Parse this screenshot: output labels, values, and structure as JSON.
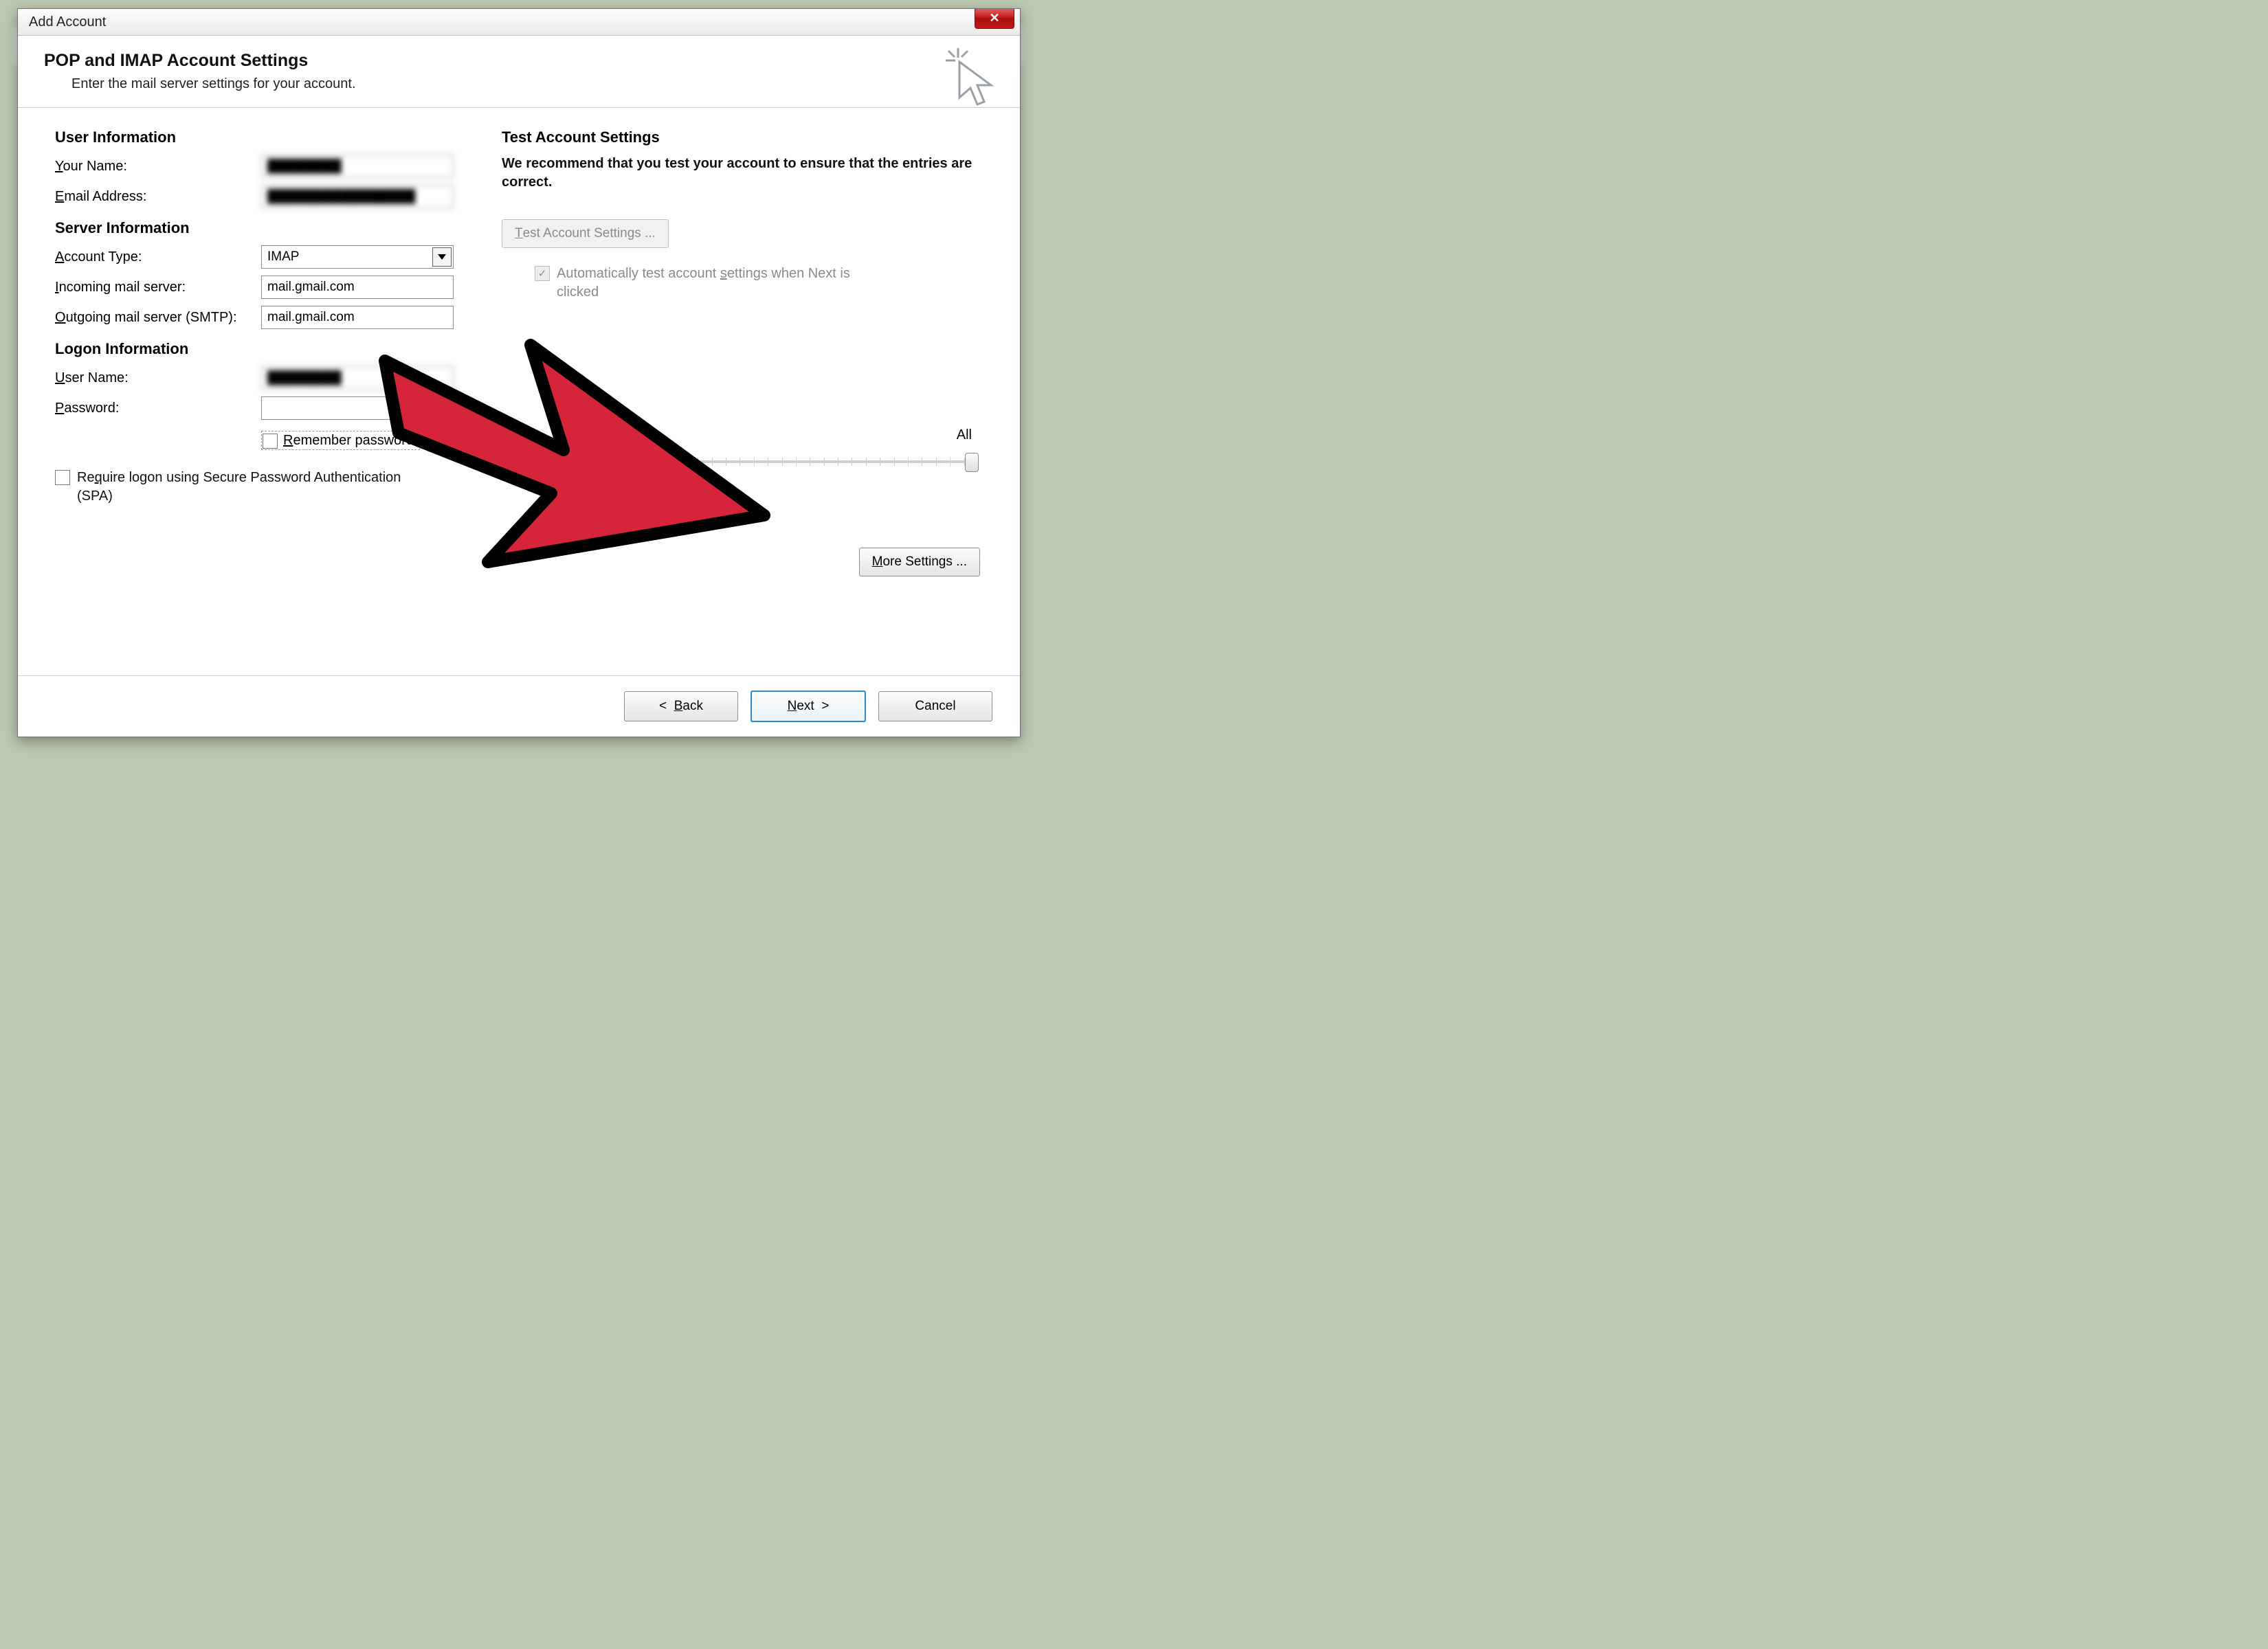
{
  "window": {
    "title": "Add Account",
    "close_glyph": "✕"
  },
  "header": {
    "title": "POP and IMAP Account Settings",
    "subtitle": "Enter the mail server settings for your account."
  },
  "user_info": {
    "heading": "User Information",
    "your_name_label": "Your Name:",
    "your_name_value": "████████",
    "email_label": "Email Address:",
    "email_value": "████████████████"
  },
  "server_info": {
    "heading": "Server Information",
    "account_type_label": "Account Type:",
    "account_type_value": "IMAP",
    "incoming_label": "Incoming mail server:",
    "incoming_value": "mail.gmail.com",
    "outgoing_label": "Outgoing mail server (SMTP):",
    "outgoing_value": "mail.gmail.com"
  },
  "logon": {
    "heading": "Logon Information",
    "user_label": "User Name:",
    "user_value": "████████",
    "password_label": "Password:",
    "password_value": "",
    "remember_label": "Remember password",
    "spa_label": "Require logon using Secure Password Authentication (SPA)"
  },
  "test": {
    "heading": "Test Account Settings",
    "intro": "We recommend that you test your account to ensure that the entries are correct.",
    "button": "Test Account Settings ...",
    "auto_label": "Automatically test account settings when Next is clicked"
  },
  "offline": {
    "all_label": "All"
  },
  "more_settings": "More Settings ...",
  "footer": {
    "back": "<  Back",
    "next": "Next  >",
    "cancel": "Cancel"
  }
}
